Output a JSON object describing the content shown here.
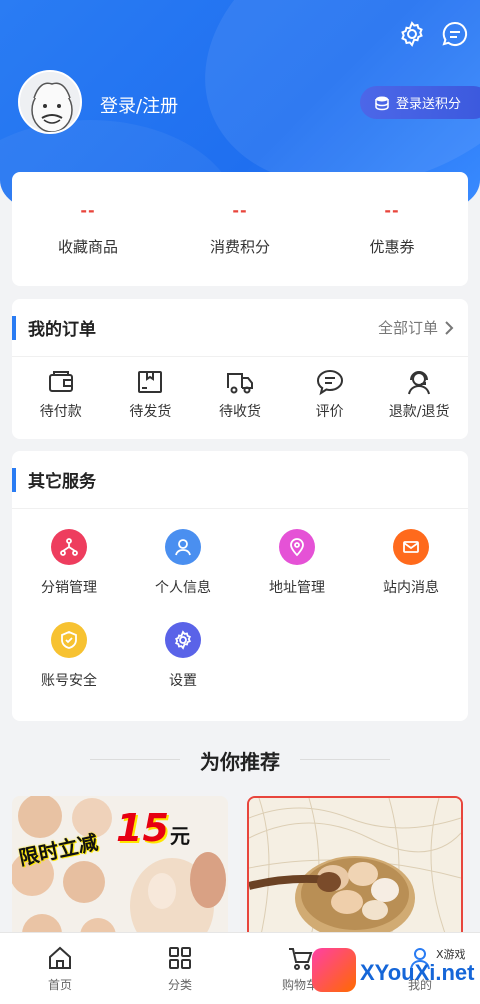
{
  "header": {
    "login_text": "登录/注册",
    "points_button": "登录送积分",
    "icons": [
      "settings-icon",
      "message-icon"
    ]
  },
  "stats": [
    {
      "value": "--",
      "label": "收藏商品"
    },
    {
      "value": "--",
      "label": "消费积分"
    },
    {
      "value": "--",
      "label": "优惠券"
    }
  ],
  "orders": {
    "title": "我的订单",
    "all_link": "全部订单",
    "items": [
      {
        "label": "待付款",
        "icon": "wallet-icon"
      },
      {
        "label": "待发货",
        "icon": "package-icon"
      },
      {
        "label": "待收货",
        "icon": "truck-icon"
      },
      {
        "label": "评价",
        "icon": "comment-icon"
      },
      {
        "label": "退款/退货",
        "icon": "service-agent-icon"
      }
    ]
  },
  "services": {
    "title": "其它服务",
    "items": [
      {
        "label": "分销管理",
        "icon": "distribution-icon",
        "color": "#ee3d5e"
      },
      {
        "label": "个人信息",
        "icon": "user-icon",
        "color": "#4a8ff0"
      },
      {
        "label": "地址管理",
        "icon": "location-icon",
        "color": "#e552d6"
      },
      {
        "label": "站内消息",
        "icon": "mail-icon",
        "color": "#ff6a1c"
      },
      {
        "label": "账号安全",
        "icon": "shield-icon",
        "color": "#f7c231"
      },
      {
        "label": "设置",
        "icon": "gear-icon",
        "color": "#5a63e8"
      }
    ]
  },
  "recommend": {
    "title": "为你推荐",
    "products": [
      {
        "badge": "限时立减",
        "amount": "15",
        "unit": "元"
      },
      {}
    ]
  },
  "tabbar": [
    {
      "label": "首页",
      "icon": "home-icon"
    },
    {
      "label": "分类",
      "icon": "category-icon"
    },
    {
      "label": "购物车",
      "icon": "cart-icon"
    },
    {
      "label": "我的",
      "icon": "profile-icon"
    }
  ],
  "watermark": {
    "text": "XYouXi.net",
    "small": "X游戏"
  }
}
